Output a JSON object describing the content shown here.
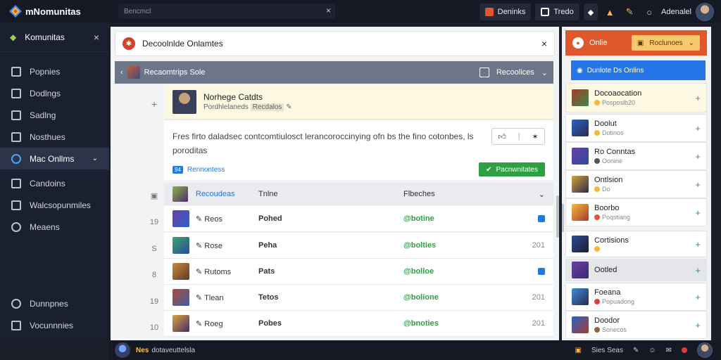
{
  "app": {
    "title": "mNomunitas"
  },
  "topbar": {
    "search_text": "Bencmcl",
    "buttons": [
      "Deninks",
      "Tredo"
    ],
    "user": "Adenalel"
  },
  "sidebar": {
    "header": "Komunitas",
    "items": [
      {
        "label": "Popnies"
      },
      {
        "label": "Dodlngs"
      },
      {
        "label": "Sadlng"
      },
      {
        "label": "Nosthues"
      },
      {
        "label": "Mac Onllms"
      },
      {
        "label": "Candoins"
      },
      {
        "label": "Walcsopunmiles"
      },
      {
        "label": "Meaens"
      }
    ],
    "bottom": [
      {
        "label": "Dunnpnes"
      },
      {
        "label": "Vocunnnies"
      }
    ]
  },
  "main": {
    "panel_title": "Decoolnlde Onlamtes",
    "subbar": {
      "title": "Recaomtrips Sole",
      "right_label": "Recoolices"
    },
    "featured": {
      "title": "Norhege Catdts",
      "subtitle": "Pordhlelaneds",
      "subtitle_tag": "Recdalos"
    },
    "card": {
      "message": "Fres firto daladsec contcomtiulosct lerancoroccinying ofn bs the fino cotonbes, ls poroditas",
      "badge": "94",
      "tag": "Rennontess",
      "action": "Pacnwnitates"
    },
    "table": {
      "headers": [
        "Recoudeas",
        "Tnlne",
        "Flbeches"
      ],
      "rows": [
        {
          "idx": "19",
          "name": "Reos",
          "class": "Pohed",
          "tag": "@botine",
          "val": ""
        },
        {
          "idx": "S",
          "name": "Rose",
          "class": "Peha",
          "tag": "@bolties",
          "val": "201"
        },
        {
          "idx": "8",
          "name": "Rutoms",
          "class": "Pats",
          "tag": "@bolloe",
          "val": ""
        },
        {
          "idx": "19",
          "name": "Tlean",
          "class": "Tetos",
          "tag": "@bolione",
          "val": "201"
        },
        {
          "idx": "10",
          "name": "Roeg",
          "class": "Pobes",
          "tag": "@bnoties",
          "val": "201"
        }
      ]
    }
  },
  "right": {
    "header": "Onlie",
    "dropdown": "Roclunoes",
    "blue_label": "Dunlote Ds Onlins",
    "items": [
      {
        "name": "Docoaocation",
        "sub": "Posposlb20"
      },
      {
        "name": "Doolut",
        "sub": "Dotinos"
      },
      {
        "name": "Ro Conntas",
        "sub": "Oonine"
      },
      {
        "name": "Ontlsion",
        "sub": "Do"
      },
      {
        "name": "Boorbo",
        "sub": "Poqstiang"
      },
      {
        "name": "Cortisions",
        "sub": ""
      },
      {
        "name": "Ootled",
        "sub": ""
      },
      {
        "name": "Foeana",
        "sub": "Popuadong"
      },
      {
        "name": "Doodor",
        "sub": "Sonecos"
      }
    ]
  },
  "bottombar": {
    "highlight": "Nes",
    "text": "dotaveuttelsla",
    "right_text": "Sies Seas"
  },
  "colors": {
    "accent_orange": "#e0572c",
    "accent_blue": "#2575e6",
    "accent_green": "#2ea043"
  }
}
